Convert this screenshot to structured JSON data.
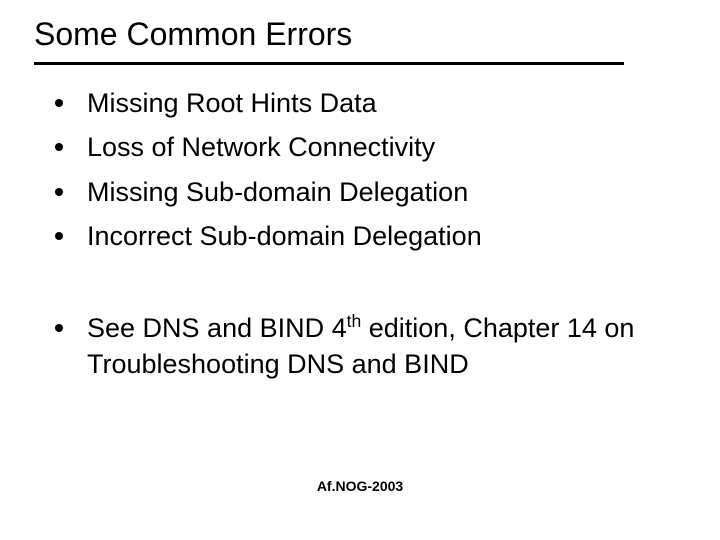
{
  "title": "Some Common Errors",
  "bullets_group1": [
    "Missing Root Hints Data",
    "Loss of Network Connectivity",
    "Missing Sub-domain Delegation",
    "Incorrect Sub-domain Delegation"
  ],
  "ref": {
    "pre": "See DNS and BIND 4",
    "sup": "th",
    "post": " edition, Chapter 14 on Troubleshooting DNS and BIND"
  },
  "footer": "Af.NOG-2003"
}
